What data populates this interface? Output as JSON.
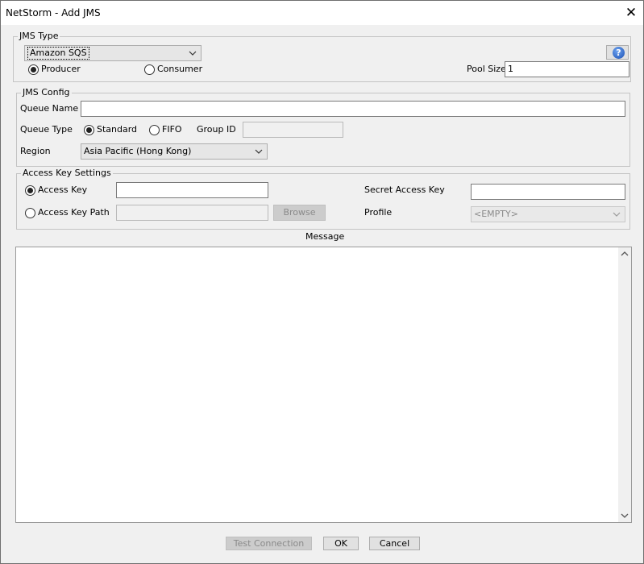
{
  "window": {
    "title": "NetStorm - Add JMS",
    "close_glyph": "✕"
  },
  "jms_type": {
    "legend": "JMS Type",
    "type_value": "Amazon SQS",
    "mode_options": [
      {
        "label": "Producer",
        "selected": true
      },
      {
        "label": "Consumer",
        "selected": false
      }
    ],
    "pool_size_label": "Pool Size",
    "pool_size_value": "1",
    "help_glyph": "?"
  },
  "jms_config": {
    "legend": "JMS Config",
    "queue_name_label": "Queue Name",
    "queue_name_value": "",
    "queue_type_label": "Queue Type",
    "queue_type_options": [
      {
        "label": "Standard",
        "selected": true
      },
      {
        "label": "FIFO",
        "selected": false
      }
    ],
    "group_id_label": "Group ID",
    "group_id_value": "",
    "region_label": "Region",
    "region_value": "Asia Pacific (Hong Kong)"
  },
  "access_key_settings": {
    "legend": "Access Key Settings",
    "access_key_label": "Access Key",
    "access_key_selected": true,
    "access_key_value": "",
    "access_key_path_label": "Access Key Path",
    "access_key_path_selected": false,
    "access_key_path_value": "",
    "browse_label": "Browse",
    "secret_access_key_label": "Secret Access Key",
    "secret_access_key_value": "",
    "profile_label": "Profile",
    "profile_value": "<EMPTY>"
  },
  "message": {
    "label": "Message",
    "value": ""
  },
  "footer": {
    "test_connection_label": "Test Connection",
    "ok_label": "OK",
    "cancel_label": "Cancel"
  },
  "icons": {
    "close": "close-icon",
    "help": "help-icon",
    "dropdown": "chevron-down-icon",
    "scroll_up": "scroll-up-icon",
    "scroll_down": "scroll-down-icon"
  },
  "colors": {
    "window_bg": "#f0f0f0",
    "titlebar_bg": "#ffffff",
    "help_blue": "#1a4fb3",
    "disabled_text": "#8a8a8a"
  }
}
